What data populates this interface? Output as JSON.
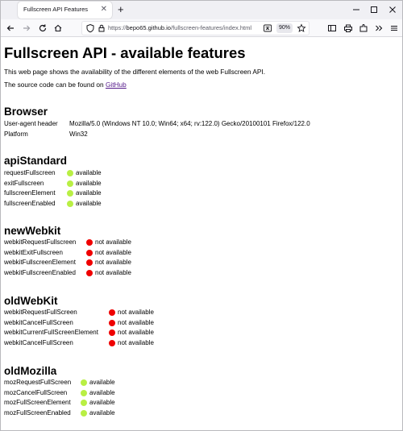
{
  "tab": {
    "title": "Fullscreen API Features"
  },
  "url": {
    "scheme": "https://",
    "host": "bepo65.github.io",
    "path": "/fullscreen-features/index.html"
  },
  "zoom": "90%",
  "page": {
    "title": "Fullscreen API - available features",
    "intro": "This web page shows the availability of the different elements of the web Fullscreen API.",
    "source_prefix": "The source code can be found on ",
    "source_link": "GitHub"
  },
  "browser": {
    "heading": "Browser",
    "rows": [
      {
        "label": "User-agent header",
        "value": "Mozilla/5.0 (Windows NT 10.0; Win64; x64; rv:122.0) Gecko/20100101 Firefox/122.0"
      },
      {
        "label": "Platform",
        "value": "Win32"
      }
    ]
  },
  "colors": {
    "available": "#b9ef44",
    "not_available": "#ef0000",
    "link": "#551a8b"
  },
  "sections": [
    {
      "heading": "apiStandard",
      "items": [
        {
          "name": "requestFullscreen",
          "status": "available"
        },
        {
          "name": "exitFullscreen",
          "status": "available"
        },
        {
          "name": "fullscreenElement",
          "status": "available"
        },
        {
          "name": "fullscreenEnabled",
          "status": "available"
        }
      ]
    },
    {
      "heading": "newWebkit",
      "items": [
        {
          "name": "webkitRequestFullscreen",
          "status": "not available"
        },
        {
          "name": "webkitExitFullscreen",
          "status": "not available"
        },
        {
          "name": "webkitFullscreenElement",
          "status": "not available"
        },
        {
          "name": "webkitFullscreenEnabled",
          "status": "not available"
        }
      ]
    },
    {
      "heading": "oldWebKit",
      "items": [
        {
          "name": "webkitRequestFullScreen",
          "status": "not available"
        },
        {
          "name": "webkitCancelFullScreen",
          "status": "not available"
        },
        {
          "name": "webkitCurrentFullScreenElement",
          "status": "not available"
        },
        {
          "name": "webkitCancelFullScreen",
          "status": "not available"
        }
      ]
    },
    {
      "heading": "oldMozilla",
      "items": [
        {
          "name": "mozRequestFullScreen",
          "status": "available"
        },
        {
          "name": "mozCancelFullScreen",
          "status": "available"
        },
        {
          "name": "mozFullScreenElement",
          "status": "available"
        },
        {
          "name": "mozFullScreenEnabled",
          "status": "available"
        }
      ]
    }
  ]
}
